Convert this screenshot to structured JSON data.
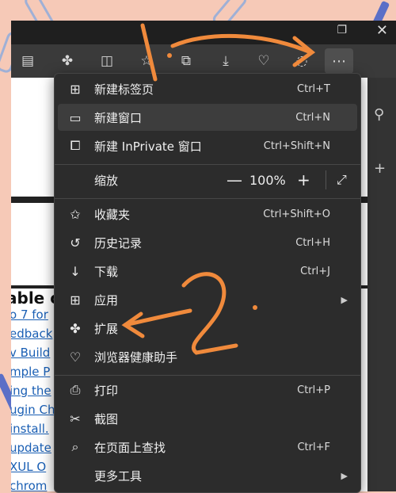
{
  "titlebar": {
    "restore_glyph": "❐",
    "close_glyph": "✕"
  },
  "toolbar": {
    "icons": [
      "page-icon",
      "extensions-icon",
      "split-screen-icon",
      "favorites-icon",
      "collections-icon",
      "downloads-icon",
      "browser-essentials-icon",
      "copilot-icon",
      "more-icon"
    ]
  },
  "page": {
    "heading": "able c",
    "links": [
      "o 7 for",
      "edback",
      "v Build",
      "mple P",
      "ing the",
      "ugin Ch",
      "install.",
      "update",
      "XUL O",
      "chrom"
    ]
  },
  "menu": {
    "items": [
      {
        "label": "新建标签页",
        "shortcut": "Ctrl+T",
        "icon": "new-tab-icon"
      },
      {
        "label": "新建窗口",
        "shortcut": "Ctrl+N",
        "icon": "new-window-icon"
      },
      {
        "label": "新建 InPrivate 窗口",
        "shortcut": "Ctrl+Shift+N",
        "icon": "inprivate-icon"
      },
      {
        "label": "收藏夹",
        "shortcut": "Ctrl+Shift+O",
        "icon": "favorites-icon"
      },
      {
        "label": "历史记录",
        "shortcut": "Ctrl+H",
        "icon": "history-icon"
      },
      {
        "label": "下载",
        "shortcut": "Ctrl+J",
        "icon": "download-icon"
      },
      {
        "label": "应用",
        "shortcut": "",
        "icon": "apps-icon"
      },
      {
        "label": "扩展",
        "shortcut": "",
        "icon": "extensions-icon"
      },
      {
        "label": "浏览器健康助手",
        "shortcut": "",
        "icon": "browser-essentials-icon"
      },
      {
        "label": "打印",
        "shortcut": "Ctrl+P",
        "icon": "print-icon"
      },
      {
        "label": "截图",
        "shortcut": "",
        "icon": "screenshot-icon"
      },
      {
        "label": "在页面上查找",
        "shortcut": "Ctrl+F",
        "icon": "find-icon"
      },
      {
        "label": "更多工具",
        "shortcut": "",
        "icon": "more-tools-icon"
      }
    ],
    "zoom": {
      "label": "缩放",
      "minus": "—",
      "value": "100%",
      "plus": "+",
      "fullscreen": "⤢"
    }
  },
  "annotations": {
    "mark_1": "1.",
    "mark_2": "2."
  }
}
